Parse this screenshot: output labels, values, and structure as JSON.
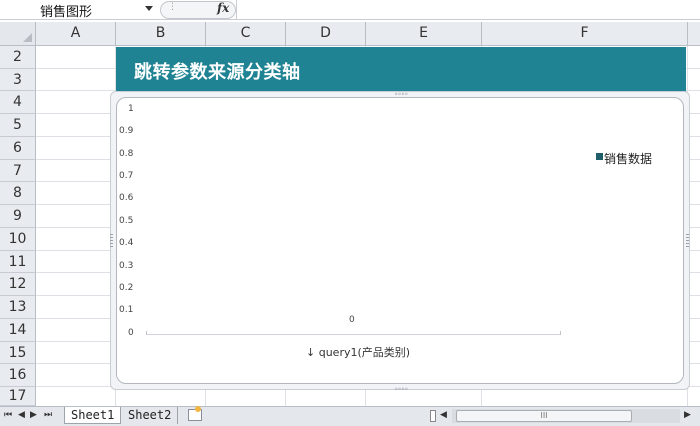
{
  "formula_bar": {
    "name_box": "销售图形",
    "fx": "fx",
    "formula": ""
  },
  "columns": [
    "A",
    "B",
    "C",
    "D",
    "E",
    "F"
  ],
  "rows": [
    "2",
    "3",
    "4",
    "5",
    "6",
    "7",
    "8",
    "9",
    "10",
    "11",
    "12",
    "13",
    "14",
    "15",
    "16",
    "17"
  ],
  "banner": {
    "title": "跳转参数来源分类轴"
  },
  "chart_data": {
    "type": "bar",
    "title": "",
    "xlabel": "query1(产品类别)",
    "ylabel": "",
    "ylim": [
      0,
      1
    ],
    "yticks": [
      "1",
      "0.9",
      "0.8",
      "0.7",
      "0.6",
      "0.5",
      "0.4",
      "0.3",
      "0.2",
      "0.1",
      "0"
    ],
    "categories": [],
    "series": [
      {
        "name": "销售数据",
        "values": []
      }
    ],
    "data_label": "0",
    "legend_position": "right",
    "grid": false,
    "colors": {
      "series": "#1f5e6a"
    }
  },
  "colors": {
    "banner": "#1f8393",
    "header_bg": "#e8ebef"
  },
  "sheets": [
    {
      "label": "Sheet1",
      "active": true
    },
    {
      "label": "Sheet2",
      "active": false
    }
  ],
  "scrollbar": {
    "thumb_label": "III"
  }
}
